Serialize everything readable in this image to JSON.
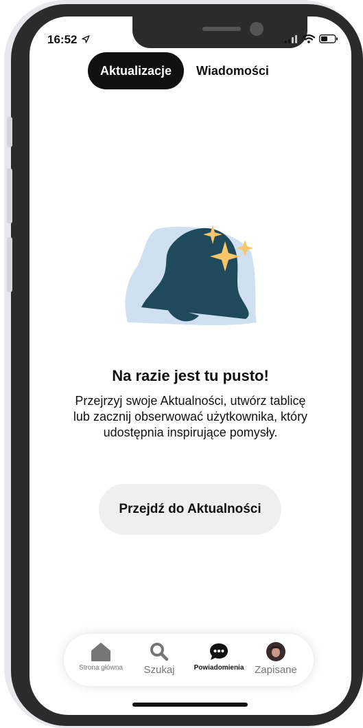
{
  "status_bar": {
    "time": "16:52",
    "location_icon": "location-arrow-icon",
    "signal_icon": "signal-bars-icon",
    "wifi_icon": "wifi-icon",
    "battery_icon": "battery-icon"
  },
  "tabs": [
    {
      "label": "Aktualizacje",
      "active": true
    },
    {
      "label": "Wiadomości",
      "active": false
    }
  ],
  "empty_state": {
    "illustration_icon": "bell-sparkles-icon",
    "title": "Na razie jest tu pusto!",
    "message": "Przejrzyj swoje Aktualności, utwórz tablicę lub zacznij obserwować użytkownika, który udostępnia inspirujące pomysły.",
    "button_label": "Przejdź do Aktualności"
  },
  "bottom_nav": [
    {
      "label": "Strona główna",
      "icon": "home-icon",
      "active": false
    },
    {
      "label": "Szukaj",
      "icon": "search-icon",
      "active": false
    },
    {
      "label": "Powiadomienia",
      "icon": "speech-bubble-icon",
      "active": true
    },
    {
      "label": "Zapisane",
      "icon": "avatar",
      "active": false
    }
  ],
  "colors": {
    "tab_active_bg": "#111111",
    "bell": "#1f4a5c",
    "bell_background": "#cfe1f0",
    "sparkle": "#f7c66b",
    "button_bg": "#efefef",
    "nav_inactive": "#767676"
  }
}
